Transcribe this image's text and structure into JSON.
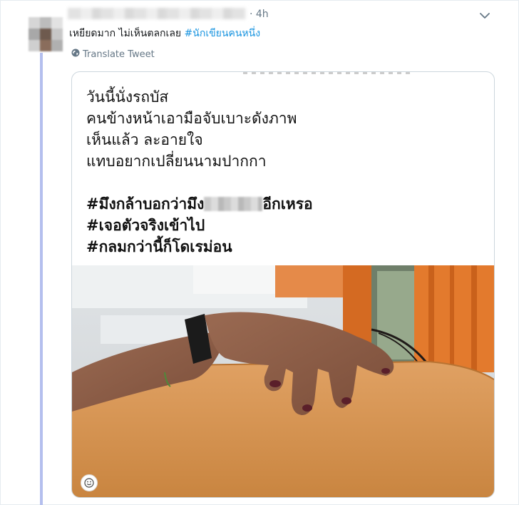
{
  "tweet": {
    "timestamp": "· 4h",
    "text_plain": "เหยียดมาก ไม่เห็นตลกเลย ",
    "hashtag": "#นักเขียนคนหนึ่ง",
    "translate_label": "Translate Tweet"
  },
  "card": {
    "poem_lines": [
      "วันนี้นั่งรถบัส",
      "คนข้างหน้าเอามือจับเบาะดังภาพ",
      "เห็นแล้ว ละอายใจ",
      "แทบอยากเปลี่ยนนามปากกา"
    ],
    "hashtag_line1_before": "#มึงกล้าบอกว่ามึง",
    "hashtag_line1_after": "อีกเหรอ",
    "hashtag_line2": "#เจอตัวจริงเข้าไป",
    "hashtag_line3": "#กลมกว่านี้ก็โดเรม่อน"
  },
  "icons": {
    "caret": "chevron-down-icon",
    "translate": "globe-icon",
    "emoji": "smiley-icon"
  },
  "colors": {
    "link": "#1b95e0",
    "muted": "#657786",
    "thread": "#b4bfee",
    "seat": "#d38a3e"
  }
}
